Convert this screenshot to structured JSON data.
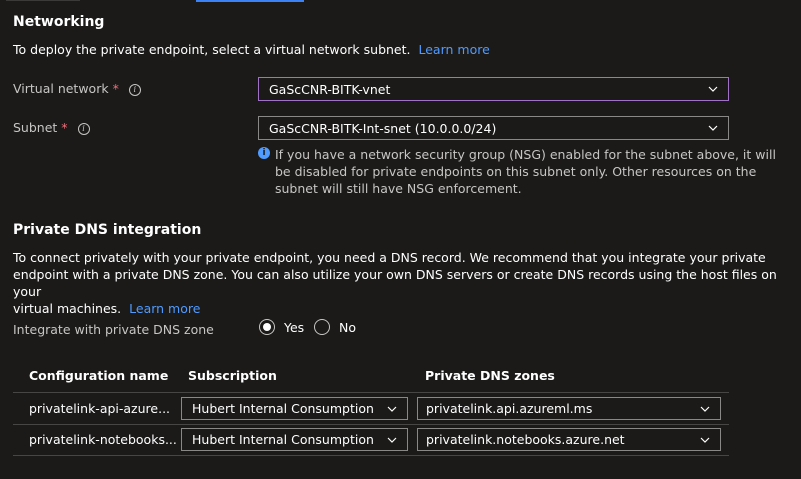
{
  "networking": {
    "title": "Networking",
    "description": "To deploy the private endpoint, select a virtual network subnet.",
    "learn_more": "Learn more",
    "virtual_network": {
      "label": "Virtual network",
      "required": "*",
      "value": "GaScCNR-BITK-vnet"
    },
    "subnet": {
      "label": "Subnet",
      "required": "*",
      "value": "GaScCNR-BITK-Int-snet (10.0.0.0/24)"
    },
    "nsg_note": {
      "line1": "If you have a network security group (NSG) enabled for the subnet above, it will",
      "line2": "be disabled for private endpoints on this subnet only. Other resources on the",
      "line3": "subnet will still have NSG enforcement."
    }
  },
  "dns": {
    "title": "Private DNS integration",
    "desc_line1": "To connect privately with your private endpoint, you need a DNS record. We recommend that you integrate your private",
    "desc_line2": "endpoint with a private DNS zone. You can also utilize your own DNS servers or create DNS records using the host files on your",
    "desc_line3": "virtual machines.",
    "learn_more": "Learn more",
    "integrate_label": "Integrate with private DNS zone",
    "yes": "Yes",
    "no": "No",
    "selected": "Yes",
    "table": {
      "headers": [
        "Configuration name",
        "Subscription",
        "Private DNS zones"
      ],
      "rows": [
        {
          "name": "privatelink-api-azure...",
          "subscription": "Hubert Internal Consumption",
          "zone": "privatelink.api.azureml.ms"
        },
        {
          "name": "privatelink-notebooks...",
          "subscription": "Hubert Internal Consumption",
          "zone": "privatelink.notebooks.azure.net"
        }
      ]
    }
  },
  "colors": {
    "background": "#1b1a19",
    "link": "#4f9bff",
    "required": "#f1707b",
    "focus_border": "#a071c7"
  },
  "icons": [
    "info-icon",
    "chevron-down-icon",
    "info-filled-icon"
  ]
}
